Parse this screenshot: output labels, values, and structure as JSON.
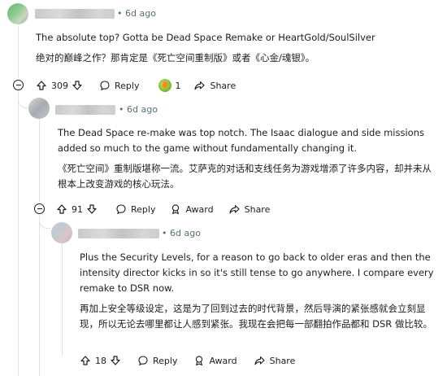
{
  "comment1": {
    "time": "6d ago",
    "text_en": "The absolute top? Gotta be Dead Space Remake or HeartGold/SoulSilver",
    "text_zh": "绝对的巅峰之作？那肯定是《死亡空间重制版》或者《心金/魂银》。",
    "votes": "309",
    "reply_label": "Reply",
    "award_count": "1",
    "share_label": "Share"
  },
  "comment2": {
    "time": "6d ago",
    "text_en": "The Dead Space re-make was top notch. The Isaac dialogue and side missions added so much to the game without fundamentally changing it.",
    "text_zh": "《死亡空间》重制版堪称一流。艾萨克的对话和支线任务为游戏增添了许多内容，却并未从根本上改变游戏的核心玩法。",
    "votes": "91",
    "reply_label": "Reply",
    "award_label": "Award",
    "share_label": "Share"
  },
  "comment3": {
    "time": "6d ago",
    "text_en": "Plus the Security Levels, for a reason to go back to older eras and then the intensity director kicks in so it's still tense to go anywhere. I compare every remake to DSR now.",
    "text_zh": "再加上安全等级设定，这是为了回到过去的时代背景，然后导演的紧张感就会立刻显现，所以无论去哪里都让人感到紧张。我现在会把每一部翻拍作品都和 DSR 做比较。",
    "votes": "18",
    "reply_label": "Reply",
    "award_label": "Award",
    "share_label": "Share"
  }
}
